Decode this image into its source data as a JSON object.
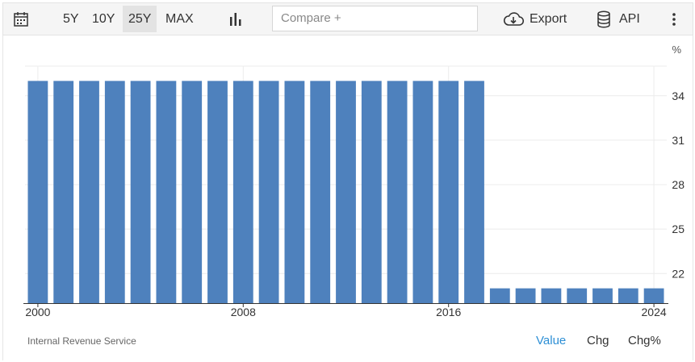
{
  "toolbar": {
    "ranges": [
      "5Y",
      "10Y",
      "25Y",
      "MAX"
    ],
    "active_range": "25Y",
    "compare_placeholder": "Compare +",
    "export_label": "Export",
    "api_label": "API"
  },
  "chart_data": {
    "type": "bar",
    "unit_label": "%",
    "color": "#4e81bd",
    "x": [
      2000,
      2001,
      2002,
      2003,
      2004,
      2005,
      2006,
      2007,
      2008,
      2009,
      2010,
      2011,
      2012,
      2013,
      2014,
      2015,
      2016,
      2017,
      2018,
      2019,
      2020,
      2021,
      2022,
      2023,
      2024
    ],
    "values": [
      35,
      35,
      35,
      35,
      35,
      35,
      35,
      35,
      35,
      35,
      35,
      35,
      35,
      35,
      35,
      35,
      35,
      35,
      21,
      21,
      21,
      21,
      21,
      21,
      21
    ],
    "ylim": [
      20,
      36
    ],
    "yticks": [
      22,
      25,
      28,
      31,
      34
    ],
    "xticks": [
      2000,
      2008,
      2016,
      2024
    ],
    "grid": true
  },
  "footer": {
    "source": "Internal Revenue Service",
    "tabs": [
      "Value",
      "Chg",
      "Chg%"
    ],
    "active_tab": "Value"
  }
}
